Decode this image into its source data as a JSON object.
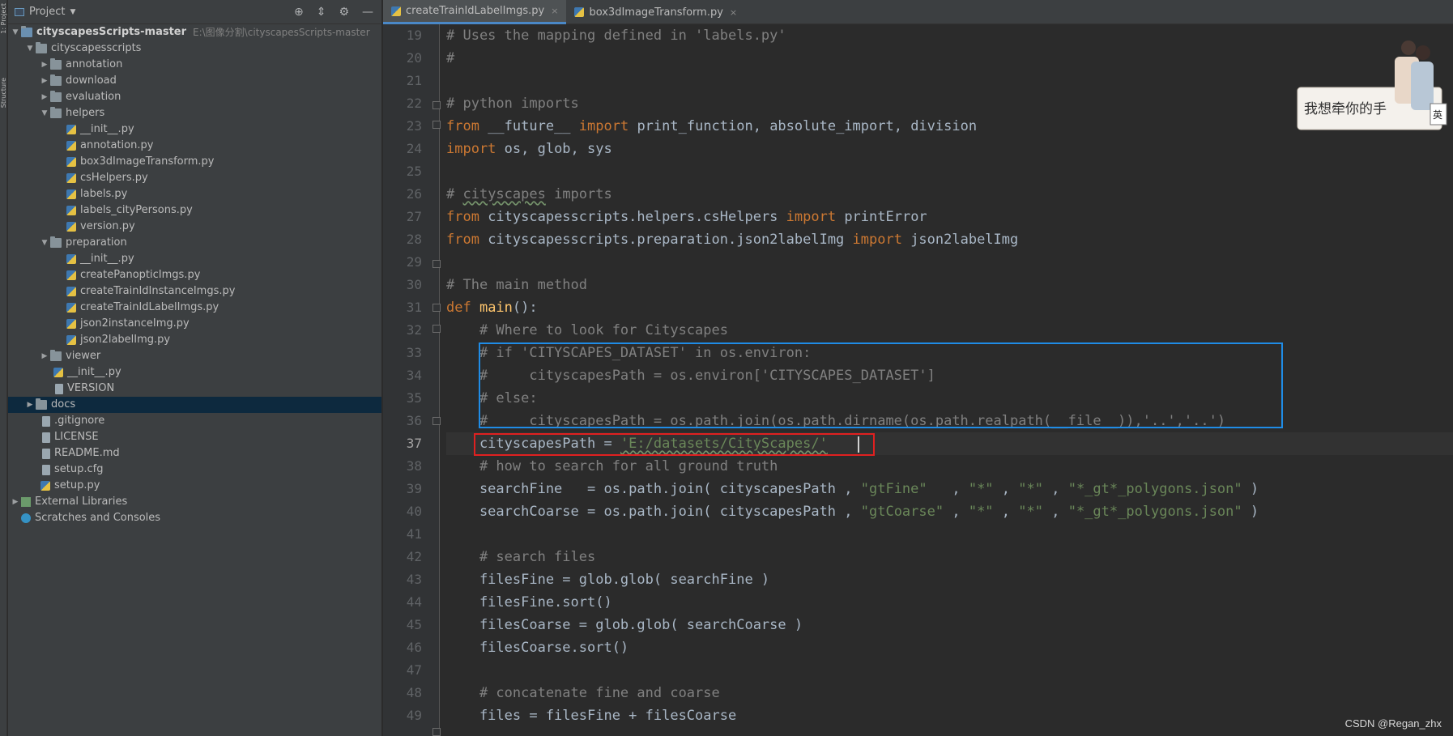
{
  "left_stripe": {
    "tabs": [
      "1: Project",
      "Structure"
    ]
  },
  "project_panel": {
    "title": "Project",
    "tree": [
      {
        "label": "cityscapesScripts-master",
        "path": "E:\\图像分割\\cityscapesScripts-master",
        "bold": true,
        "expanded": true
      },
      {
        "label": "cityscapesscripts",
        "expanded": true
      },
      {
        "label": "annotation"
      },
      {
        "label": "download"
      },
      {
        "label": "evaluation"
      },
      {
        "label": "helpers",
        "expanded": true
      },
      {
        "label": "__init__.py"
      },
      {
        "label": "annotation.py"
      },
      {
        "label": "box3dImageTransform.py"
      },
      {
        "label": "csHelpers.py"
      },
      {
        "label": "labels.py"
      },
      {
        "label": "labels_cityPersons.py"
      },
      {
        "label": "version.py"
      },
      {
        "label": "preparation",
        "expanded": true
      },
      {
        "label": "__init__.py"
      },
      {
        "label": "createPanopticImgs.py"
      },
      {
        "label": "createTrainIdInstanceImgs.py"
      },
      {
        "label": "createTrainIdLabelImgs.py"
      },
      {
        "label": "json2instanceImg.py"
      },
      {
        "label": "json2labelImg.py"
      },
      {
        "label": "viewer"
      },
      {
        "label": "__init__.py"
      },
      {
        "label": "VERSION"
      },
      {
        "label": "docs"
      },
      {
        "label": ".gitignore"
      },
      {
        "label": "LICENSE"
      },
      {
        "label": "README.md"
      },
      {
        "label": "setup.cfg"
      },
      {
        "label": "setup.py"
      },
      {
        "label": "External Libraries"
      },
      {
        "label": "Scratches and Consoles"
      }
    ]
  },
  "editor": {
    "tabs": [
      {
        "label": "createTrainIdLabelImgs.py",
        "active": true
      },
      {
        "label": "box3dImageTransform.py",
        "active": false
      }
    ],
    "close_glyph": "×",
    "line_numbers": [
      "19",
      "20",
      "21",
      "22",
      "23",
      "24",
      "25",
      "26",
      "27",
      "28",
      "29",
      "30",
      "31",
      "32",
      "33",
      "34",
      "35",
      "36",
      "37",
      "38",
      "39",
      "40",
      "41",
      "42",
      "43",
      "44",
      "45",
      "46",
      "47",
      "48",
      "49"
    ],
    "current_line": "37",
    "lines": {
      "l19": "# Uses the mapping defined in 'labels.py'",
      "l20": "#",
      "l22": "# python imports",
      "l23_kw1": "from",
      "l23_a": " __future__ ",
      "l23_kw2": "import",
      "l23_b": " print_function, absolute_import, division",
      "l24_kw": "import",
      "l24_a": " os, glob, sys",
      "l26_a": "# ",
      "l26_b": "cityscapes",
      "l26_c": " imports",
      "l27_kw1": "from",
      "l27_a": " cityscapesscripts.helpers.csHelpers ",
      "l27_kw2": "import",
      "l27_b": " printError",
      "l28_kw1": "from",
      "l28_a": " cityscapesscripts.preparation.json2labelImg ",
      "l28_kw2": "import",
      "l28_b": " json2labelImg",
      "l30": "# The main method",
      "l31_kw": "def",
      "l31_fn": " main",
      "l31_b": "():",
      "l32": "    # Where to look for Cityscapes",
      "l33": "    # if 'CITYSCAPES_DATASET' in os.environ:",
      "l34": "    #     cityscapesPath = os.environ['CITYSCAPES_DATASET']",
      "l35": "    # else:",
      "l36": "    #     cityscapesPath = os.path.join(os.path.dirname(os.path.realpath(__file__)),'..','..')",
      "l37_a": "    cityscapesPath = ",
      "l37_s": "'E:/datasets/CityScapes/'",
      "l38": "    # how to search for all ground truth",
      "l39_a": "    searchFine   = os.path.join( cityscapesPath , ",
      "l39_s1": "\"gtFine\"",
      "l39_b": "   , ",
      "l39_s2": "\"*\"",
      "l39_c": " , ",
      "l39_s3": "\"*\"",
      "l39_d": " , ",
      "l39_s4": "\"*_gt*_polygons.json\"",
      "l39_e": " )",
      "l40_a": "    searchCoarse = os.path.join( cityscapesPath , ",
      "l40_s1": "\"gtCoarse\"",
      "l40_b": " , ",
      "l40_s2": "\"*\"",
      "l40_c": " , ",
      "l40_s3": "\"*\"",
      "l40_d": " , ",
      "l40_s4": "\"*_gt*_polygons.json\"",
      "l40_e": " )",
      "l42": "    # search files",
      "l43": "    filesFine = glob.glob( searchFine )",
      "l44": "    filesFine.sort()",
      "l45": "    filesCoarse = glob.glob( searchCoarse )",
      "l46": "    filesCoarse.sort()",
      "l48": "    # concatenate fine and coarse",
      "l49": "    files = filesFine + filesCoarse"
    }
  },
  "decoration": {
    "text": "我想牵你的手",
    "badge": "英"
  },
  "watermark": "CSDN @Regan_zhx",
  "colors": {
    "keyword": "#cc7832",
    "string": "#6a8759",
    "comment": "#808080",
    "highlight_blue": "#1f8ce6",
    "highlight_red": "#e02020"
  }
}
